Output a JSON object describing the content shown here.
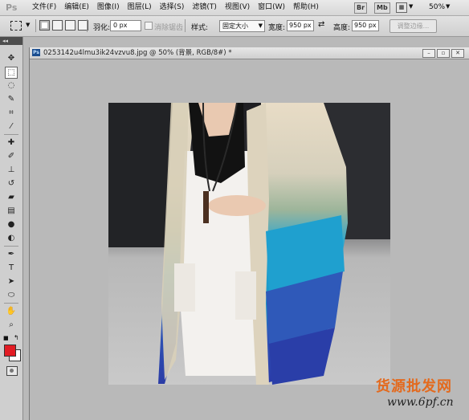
{
  "app": {
    "logo": "Ps"
  },
  "menu": {
    "items": [
      "文件(F)",
      "编辑(E)",
      "图像(I)",
      "图层(L)",
      "选择(S)",
      "滤镜(T)",
      "视图(V)",
      "窗口(W)",
      "帮助(H)"
    ]
  },
  "appbar": {
    "bridge": "Br",
    "minibridge": "Mb",
    "zoom": "50%"
  },
  "options": {
    "feather_label": "羽化:",
    "feather_value": "0 px",
    "antialias_label": "消除锯齿",
    "style_label": "样式:",
    "style_value": "固定大小",
    "width_label": "宽度:",
    "width_value": "950 px",
    "height_label": "高度:",
    "height_value": "950 px",
    "refine_edge": "调整边缘..."
  },
  "document": {
    "title": "0253142u4lmu3ik24vzvu8.jpg @ 50% (背景, RGB/8#) *"
  },
  "colors": {
    "foreground": "#e21c24",
    "background": "#ffffff"
  },
  "watermark": {
    "brand": "货源批发网",
    "url": "www.6pf.cn"
  },
  "tools": [
    "move-icon",
    "marquee-icon",
    "lasso-icon",
    "quick-select-icon",
    "crop-icon",
    "eyedropper-icon",
    "healing-icon",
    "brush-icon",
    "stamp-icon",
    "history-brush-icon",
    "eraser-icon",
    "gradient-icon",
    "blur-icon",
    "dodge-icon",
    "pen-icon",
    "type-icon",
    "path-select-icon",
    "shape-icon",
    "hand-icon",
    "zoom-icon"
  ]
}
